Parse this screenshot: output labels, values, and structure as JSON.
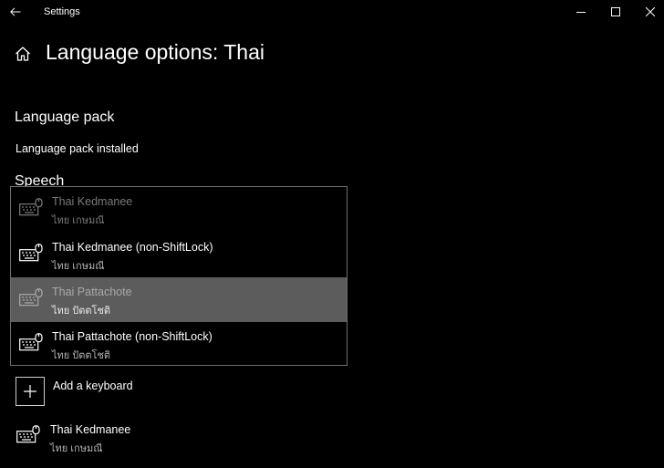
{
  "window": {
    "title": "Settings",
    "icons": {
      "back": "back-arrow-icon",
      "minimize": "minimize-icon",
      "maximize": "maximize-icon",
      "close": "close-icon"
    }
  },
  "header": {
    "title": "Language options: Thai",
    "home_icon": "home-icon"
  },
  "language_pack": {
    "title": "Language pack",
    "status": "Language pack installed"
  },
  "speech": {
    "title": "Speech"
  },
  "keyboard_flyout": {
    "items": [
      {
        "name": "Thai Kedmanee",
        "native": "ไทย เกษมณี",
        "state": "disabled"
      },
      {
        "name": "Thai Kedmanee (non-ShiftLock)",
        "native": "ไทย เกษมณี",
        "state": "normal"
      },
      {
        "name": "Thai Pattachote",
        "native": "ไทย ปัตตโชติ",
        "state": "selected"
      },
      {
        "name": "Thai Pattachote (non-ShiftLock)",
        "native": "ไทย ปัตตโชติ",
        "state": "normal"
      }
    ]
  },
  "add_keyboard": {
    "label": "Add a keyboard"
  },
  "installed_keyboard": {
    "name": "Thai Kedmanee",
    "native": "ไทย เกษมณี"
  },
  "colors": {
    "background": "#000000",
    "text": "#ffffff",
    "subtext": "#b4b4b4",
    "selected_bg": "#5c5c5c",
    "flyout_border": "#6e6e6e"
  }
}
